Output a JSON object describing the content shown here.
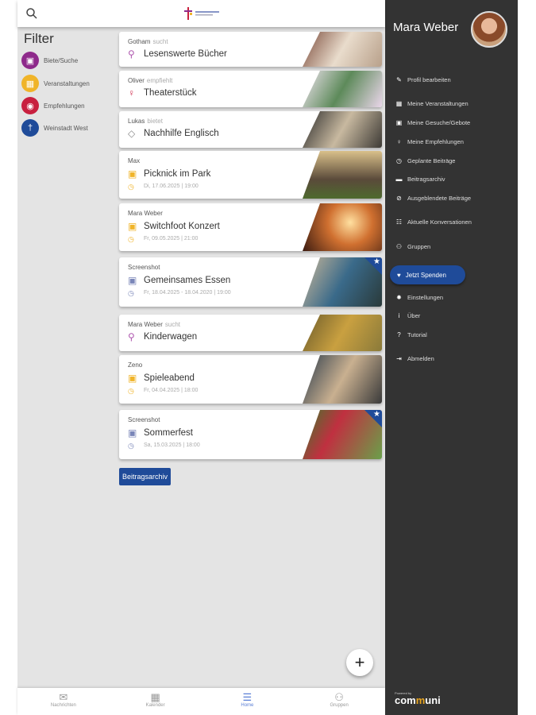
{
  "header": {
    "search_icon": "search-icon",
    "logo_text": "Ev. Kirchengemeinde Weinstadt"
  },
  "filter": {
    "title": "Filter",
    "items": [
      {
        "label": "Biete/Suche",
        "color": "#8e2a8b",
        "icon": "gift"
      },
      {
        "label": "Veranstaltungen",
        "color": "#f0b429",
        "icon": "calendar"
      },
      {
        "label": "Empfehlungen",
        "color": "#c8203f",
        "icon": "lightbulb"
      },
      {
        "label": "Weinstadt West",
        "color": "#1f4b99",
        "icon": "cross"
      }
    ]
  },
  "posts": [
    {
      "author": "Gotham",
      "verb": "sucht",
      "title": "Lesenswerte Bücher",
      "type": "search"
    },
    {
      "author": "Oliver",
      "verb": "empfiehlt",
      "title": "Theaterstück",
      "type": "recommend"
    },
    {
      "author": "Lukas",
      "verb": "bietet",
      "title": "Nachhilfe Englisch",
      "type": "offer"
    },
    {
      "author": "Max",
      "title": "Picknick im Park",
      "date": "Di, 17.06.2025 | 19:00",
      "type": "event"
    },
    {
      "author": "Mara Weber",
      "title": "Switchfoot Konzert",
      "date": "Fr, 09.05.2025 | 21:00",
      "type": "event"
    },
    {
      "author": "Screenshot",
      "title": "Gemeinsames Essen",
      "date": "Fr, 18.04.2025 - 18.04.2020 | 19:00",
      "type": "group-event",
      "starred": true
    },
    {
      "author": "Mara Weber",
      "verb": "sucht",
      "title": "Kinderwagen",
      "type": "search"
    },
    {
      "author": "Zeno",
      "title": "Spieleabend",
      "date": "Fr, 04.04.2025 | 18:00",
      "type": "event"
    },
    {
      "author": "Screenshot",
      "title": "Sommerfest",
      "date": "Sa, 15.03.2025 | 18:00",
      "type": "group-event",
      "starred": true
    }
  ],
  "archive_button": "Beitragsarchiv",
  "fab": "+",
  "bottom_nav": [
    {
      "label": "Nachrichten"
    },
    {
      "label": "Kalender"
    },
    {
      "label": "Home",
      "active": true
    },
    {
      "label": "Gruppen"
    }
  ],
  "drawer": {
    "user_name": "Mara Weber",
    "items": [
      {
        "label": "Profil bearbeiten",
        "icon": "edit-profile"
      },
      {
        "label": "Meine Veranstaltungen",
        "icon": "calendar"
      },
      {
        "label": "Meine Gesuche/Gebote",
        "icon": "gift"
      },
      {
        "label": "Meine Empfehlungen",
        "icon": "lightbulb"
      },
      {
        "label": "Geplante Beiträge",
        "icon": "clock"
      },
      {
        "label": "Beitragsarchiv",
        "icon": "archive"
      },
      {
        "label": "Ausgeblendete Beiträge",
        "icon": "eye-off"
      },
      {
        "label": "Aktuelle Konversationen",
        "icon": "chat"
      },
      {
        "label": "Gruppen",
        "icon": "group"
      }
    ],
    "donate": "Jetzt Spenden",
    "items2": [
      {
        "label": "Einstellungen",
        "icon": "gear"
      },
      {
        "label": "Über",
        "icon": "info"
      },
      {
        "label": "Tutorial",
        "icon": "question"
      },
      {
        "label": "Abmelden",
        "icon": "logout"
      }
    ],
    "powered_by": "Powered by",
    "brand": "communi"
  }
}
